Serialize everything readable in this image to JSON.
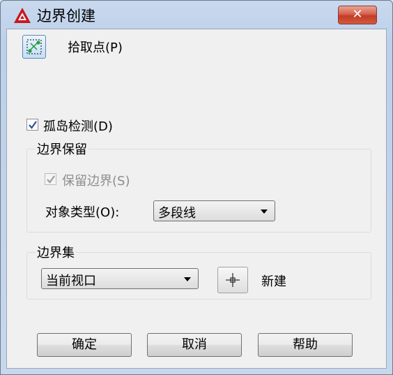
{
  "window": {
    "title": "边界创建",
    "close_label": "✕"
  },
  "pick_points": {
    "label": "拾取点(P)"
  },
  "island_detection": {
    "label": "孤岛检测(D)",
    "checked": true
  },
  "boundary_retention": {
    "group_title": "边界保留",
    "retain_label": "保留边界(S)",
    "retain_checked": true,
    "retain_enabled": false,
    "object_type_label": "对象类型(O):",
    "object_type_value": "多段线"
  },
  "boundary_set": {
    "group_title": "边界集",
    "value": "当前视口",
    "new_label": "新建"
  },
  "buttons": {
    "ok": "确定",
    "cancel": "取消",
    "help": "帮助"
  },
  "colors": {
    "close_red": "#c33c26",
    "app_icon_red": "#c8181e",
    "titlebar": "#c9d9ee"
  }
}
